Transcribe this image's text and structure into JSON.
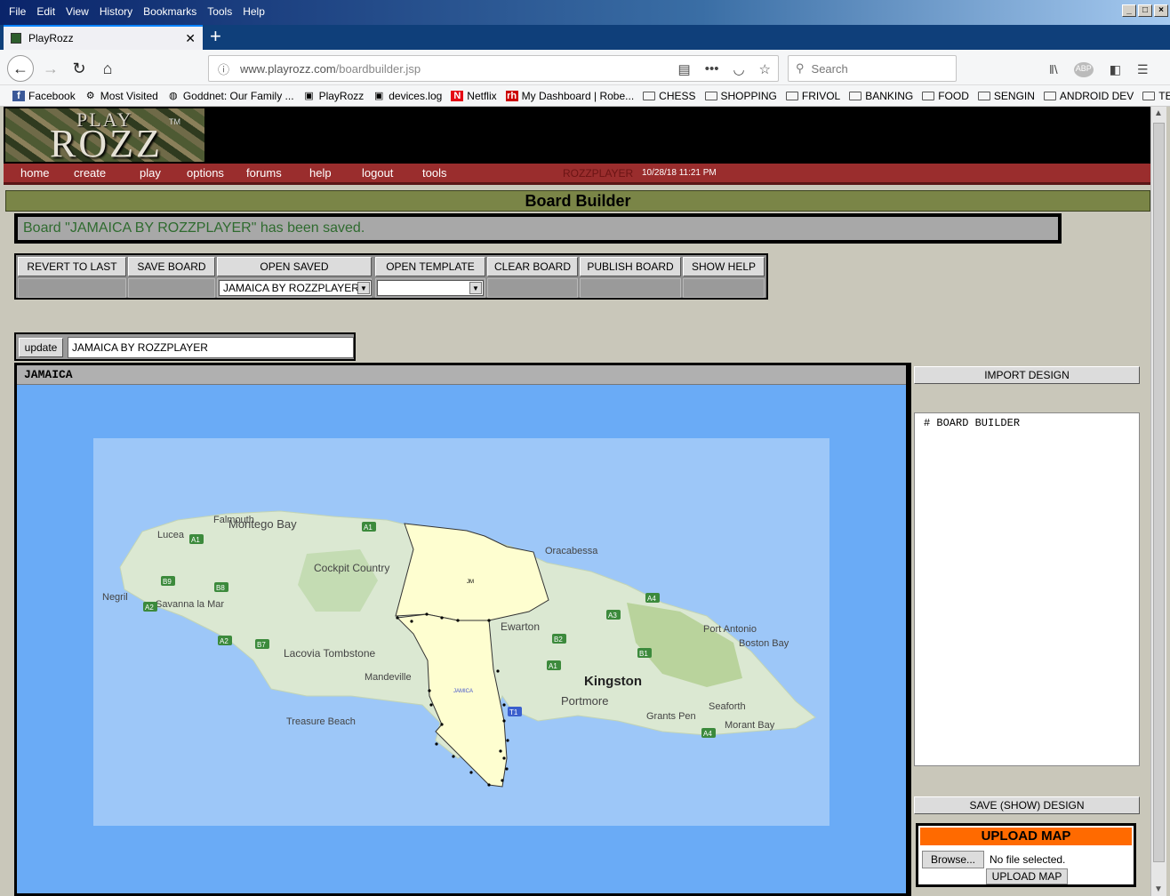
{
  "browser": {
    "menus": [
      "File",
      "Edit",
      "View",
      "History",
      "Bookmarks",
      "Tools",
      "Help"
    ],
    "tab_title": "PlayRozz",
    "url_host": "www.playrozz.com",
    "url_path": "/boardbuilder.jsp",
    "search_placeholder": "Search",
    "bookmarks": [
      {
        "label": "Facebook",
        "icon": "facebook-icon"
      },
      {
        "label": "Most Visited",
        "icon": "gear-icon"
      },
      {
        "label": "Goddnet: Our Family ...",
        "icon": "globe-icon"
      },
      {
        "label": "PlayRozz",
        "icon": "playrozz-icon"
      },
      {
        "label": "devices.log",
        "icon": "playrozz-icon"
      },
      {
        "label": "Netflix",
        "icon": "netflix-icon"
      },
      {
        "label": "My Dashboard | Robe...",
        "icon": "redhat-icon"
      },
      {
        "label": "CHESS",
        "icon": "folder-icon"
      },
      {
        "label": "SHOPPING",
        "icon": "folder-icon"
      },
      {
        "label": "FRIVOL",
        "icon": "folder-icon"
      },
      {
        "label": "BANKING",
        "icon": "folder-icon"
      },
      {
        "label": "FOOD",
        "icon": "folder-icon"
      },
      {
        "label": "SENGIN",
        "icon": "folder-icon"
      },
      {
        "label": "ANDROID DEV",
        "icon": "folder-icon"
      },
      {
        "label": "TECH",
        "icon": "folder-icon"
      }
    ]
  },
  "site": {
    "logo_top": "PLAY",
    "logo_main": "ROZZ",
    "logo_tm": "TM",
    "nav": [
      "home",
      "create",
      "play",
      "options",
      "forums",
      "help",
      "logout",
      "tools"
    ],
    "user": "ROZZPLAYER",
    "datetime": "10/28/18 11:21 PM",
    "page_title": "Board Builder",
    "saved_message": "Board \"JAMAICA BY ROZZPLAYER\" has been saved."
  },
  "toolbar": {
    "revert": "REVERT TO LAST",
    "save": "SAVE BOARD",
    "open_saved": "OPEN SAVED",
    "open_saved_value": "JAMAICA BY ROZZPLAYER",
    "open_template": "OPEN TEMPLATE",
    "open_template_value": "",
    "clear": "CLEAR BOARD",
    "publish": "PUBLISH BOARD",
    "help": "SHOW HELP"
  },
  "update": {
    "button": "update",
    "board_name": "JAMAICA BY ROZZPLAYER"
  },
  "map": {
    "header": "JAMAICA",
    "territory_1_label": "JM",
    "territory_2_label": "JAMICA",
    "places": [
      "Falmouth",
      "Montego Bay",
      "Lucea",
      "Cockpit Country",
      "Oracabessa",
      "Negril",
      "Savanna la Mar",
      "Ewarton",
      "Port Antonio",
      "Boston Bay",
      "Lacovia Tombstone",
      "Mandeville",
      "Kingston",
      "Portmore",
      "Grants Pen",
      "Seaforth",
      "Morant Bay",
      "Treasure Beach"
    ],
    "roads": [
      "A1",
      "A1",
      "B9",
      "B8",
      "A2",
      "A2",
      "B7",
      "A3",
      "A4",
      "B2",
      "B1",
      "A1",
      "T1",
      "A4"
    ],
    "colors": {
      "sea": "#6aabf6",
      "land": "#dbe8d2",
      "territory": "#fefed0"
    }
  },
  "right": {
    "import": "IMPORT DESIGN",
    "design_text": "# BOARD BUILDER",
    "save_show": "SAVE (SHOW) DESIGN",
    "upload_title": "UPLOAD MAP",
    "browse": "Browse...",
    "no_file": "No file selected.",
    "upload_button": "UPLOAD MAP"
  }
}
